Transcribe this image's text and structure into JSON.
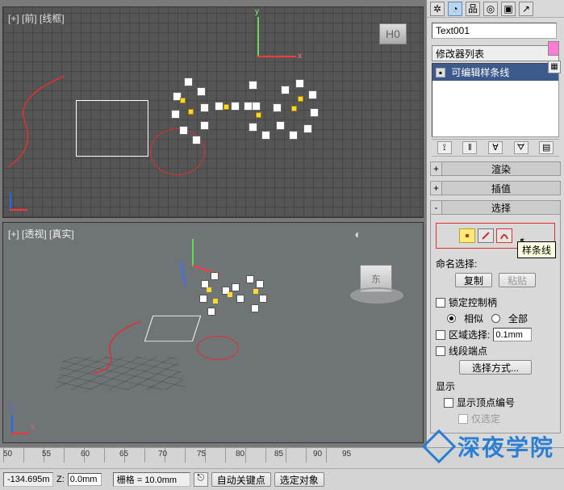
{
  "viewports": {
    "top_label": "[+] [前] [线框]",
    "bottom_label": "[+] [透视] [真实]",
    "home_cube_top": "H0",
    "home_cube_bot": "东"
  },
  "side_panel": {
    "object_name": "Text001",
    "modifier_dropdown": "修改器列表",
    "stack_item": "可编辑样条线",
    "rollouts": {
      "render": "渲染",
      "interpolation": "插值",
      "selection": "选择"
    },
    "tooltip": "样条线",
    "named_sel_label": "命名选择:",
    "copy_btn": "复制",
    "paste_btn": "粘贴",
    "lock_handles": "锁定控制柄",
    "similar": "相似",
    "all": "全部",
    "region_select": "区域选择:",
    "region_value": "0.1mm",
    "segment_end": "线段端点",
    "selection_method_btn": "选择方式...",
    "display_label": "显示",
    "show_vertex_numbers": "显示顶点编号",
    "only_selected": "仅选定"
  },
  "timeline": {
    "ticks": [
      "50",
      "55",
      "60",
      "65",
      "70",
      "75",
      "80",
      "85",
      "90",
      "95"
    ]
  },
  "statusbar": {
    "x_value": "-134.695m",
    "z_label": "Z:",
    "z_value": "0.0mm",
    "grid_label": "栅格 = 10.0mm",
    "autokey": "自动关键点",
    "sel_obj": "选定对象"
  },
  "watermark": "深夜学院"
}
